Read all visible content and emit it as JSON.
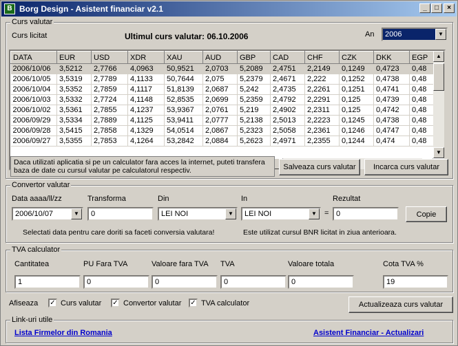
{
  "window": {
    "title": "Borg Design - Asistent financiar v2.1"
  },
  "curs": {
    "legend": "Curs valutar",
    "curs_licitat": "Curs licitat",
    "ultimul_curs": "Ultimul curs valutar: 06.10.2006",
    "an_label": "An",
    "an_value": "2006",
    "columns": [
      "DATA",
      "EUR",
      "USD",
      "XDR",
      "XAU",
      "AUD",
      "GBP",
      "CAD",
      "CHF",
      "CZK",
      "DKK",
      "EGP"
    ],
    "rows": [
      [
        "2006/10/06",
        "3,5212",
        "2,7766",
        "4,0963",
        "50,9521",
        "2,0703",
        "5,2089",
        "2,4751",
        "2,2149",
        "0,1249",
        "0,4723",
        "0,48"
      ],
      [
        "2006/10/05",
        "3,5319",
        "2,7789",
        "4,1133",
        "50,7644",
        "2,075",
        "5,2379",
        "2,4671",
        "2,222",
        "0,1252",
        "0,4738",
        "0,48"
      ],
      [
        "2006/10/04",
        "3,5352",
        "2,7859",
        "4,1117",
        "51,8139",
        "2,0687",
        "5,242",
        "2,4735",
        "2,2261",
        "0,1251",
        "0,4741",
        "0,48"
      ],
      [
        "2006/10/03",
        "3,5332",
        "2,7724",
        "4,1148",
        "52,8535",
        "2,0699",
        "5,2359",
        "2,4792",
        "2,2291",
        "0,125",
        "0,4739",
        "0,48"
      ],
      [
        "2006/10/02",
        "3,5361",
        "2,7855",
        "4,1237",
        "53,9367",
        "2,0761",
        "5,219",
        "2,4902",
        "2,2311",
        "0,125",
        "0,4742",
        "0,48"
      ],
      [
        "2006/09/29",
        "3,5334",
        "2,7889",
        "4,1125",
        "53,9411",
        "2,0777",
        "5,2138",
        "2,5013",
        "2,2223",
        "0,1245",
        "0,4738",
        "0,48"
      ],
      [
        "2006/09/28",
        "3,5415",
        "2,7858",
        "4,1329",
        "54,0514",
        "2,0867",
        "5,2323",
        "2,5058",
        "2,2361",
        "0,1246",
        "0,4747",
        "0,48"
      ],
      [
        "2006/09/27",
        "3,5355",
        "2,7853",
        "4,1264",
        "53,2842",
        "2,0884",
        "5,2623",
        "2,4971",
        "2,2355",
        "0,1244",
        "0,474",
        "0,48"
      ]
    ],
    "info_text": "Daca utilizati aplicatia si pe un calculator fara acces la internet, puteti transfera baza de date cu cursul valutar pe calculatorul respectiv.",
    "salveaza_btn": "Salveaza curs valutar",
    "incarca_btn": "Incarca curs valutar"
  },
  "convertor": {
    "legend": "Convertor valutar",
    "data_label": "Data aaaa/ll/zz",
    "data_value": "2006/10/07",
    "transforma_label": "Transforma",
    "transforma_value": "0",
    "din_label": "Din",
    "din_value": "LEI NOI",
    "in_label": "In",
    "in_value": "LEI NOI",
    "equals": "=",
    "rezultat_label": "Rezultat",
    "rezultat_value": "0",
    "copie_btn": "Copie",
    "note1": "Selectati data pentru care doriti sa faceti conversia valutara!",
    "note2": "Este utilizat cursul BNR licitat in ziua anterioara."
  },
  "tva": {
    "legend": "TVA calculator",
    "labels": [
      "Cantitatea",
      "PU Fara TVA",
      "Valoare fara TVA",
      "TVA",
      "Valoare totala",
      "Cota TVA %"
    ],
    "values": [
      "1",
      "0",
      "0",
      "0",
      "0",
      "19"
    ]
  },
  "afiseaza": {
    "label": "Afiseaza",
    "items": [
      "Curs valutar",
      "Convertor valutar",
      "TVA calculator"
    ],
    "actualizeaza_btn": "Actualizeaza curs valutar"
  },
  "links": {
    "legend": "Link-uri utile",
    "lista": "Lista Firmelor din Romania",
    "asistent": "Asistent Financiar - Actualizari"
  }
}
